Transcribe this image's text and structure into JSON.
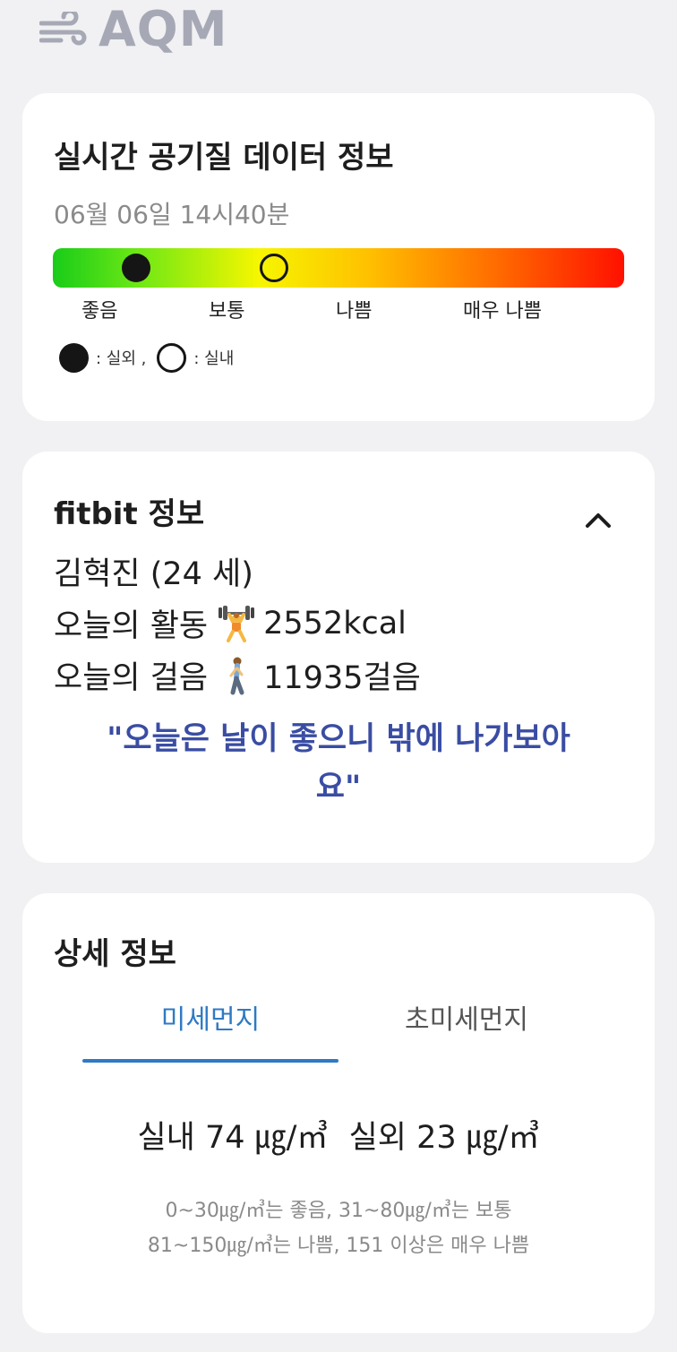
{
  "header": {
    "logo_text": "AQM",
    "logo_icon": "wind-icon"
  },
  "air_quality": {
    "title": "실시간 공기질 데이터 정보",
    "timestamp": "06월 06일 14시40분",
    "levels": [
      "좋음",
      "보통",
      "나쁨",
      "매우 나쁨"
    ],
    "legend": {
      "outdoor": ": 실외 ,",
      "indoor": ": 실내"
    },
    "gauge_colors": [
      "#19cc19",
      "#f6f600",
      "#ff6a00",
      "#ff1000"
    ]
  },
  "fitbit": {
    "title": "fitbit 정보",
    "user": "김혁진 (24 세)",
    "activity_label": "오늘의 활동",
    "activity_value": "2552kcal",
    "activity_icon": "weightlifter-icon",
    "steps_label": "오늘의 걸음",
    "steps_value": "11935걸음",
    "steps_icon": "walking-person-icon",
    "message_line1": "\"오늘은 날이 좋으니 밖에 나가보아",
    "message_line2": "요\"",
    "collapse_icon": "chevron-up-icon"
  },
  "detail": {
    "title": "상세 정보",
    "tabs": [
      {
        "label": "미세먼지",
        "active": true
      },
      {
        "label": "초미세먼지",
        "active": false
      }
    ],
    "indoor_reading": "실내 74 ㎍/㎥",
    "outdoor_reading": "실외 23 ㎍/㎥",
    "scale_line1": "0~30㎍/㎥는 좋음, 31~80㎍/㎥는 보통",
    "scale_line2": "81~150㎍/㎥는 나쁨, 151 이상은 매우 나쁨"
  },
  "colors": {
    "accent": "#2e7ac5",
    "message": "#3a4da3",
    "background": "#f1f1f3"
  }
}
